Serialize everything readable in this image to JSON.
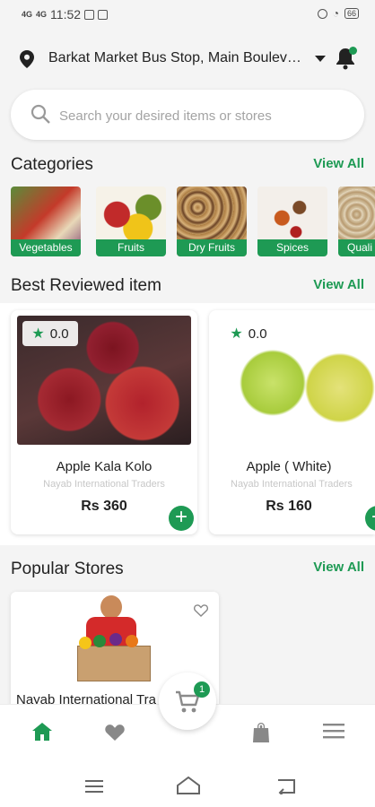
{
  "status_bar": {
    "time": "11:52",
    "left_signal_1": "4G",
    "left_signal_2": "4G",
    "battery": "66"
  },
  "header": {
    "location": "Barkat Market Bus Stop, Main Boulevard...",
    "location_icon": "map-pin-icon",
    "notification_icon": "bell-icon",
    "notification_dot": true
  },
  "search": {
    "placeholder": "Search your desired items or stores",
    "value": ""
  },
  "categories": {
    "title": "Categories",
    "view_all": "View All",
    "items": [
      {
        "label": "Vegetables"
      },
      {
        "label": "Fruits"
      },
      {
        "label": "Dry Fruits"
      },
      {
        "label": "Spices"
      },
      {
        "label": "Quali"
      }
    ]
  },
  "best_reviewed": {
    "title": "Best Reviewed item",
    "view_all": "View All",
    "items": [
      {
        "name": "Apple Kala Kolo",
        "store": "Nayab International Traders",
        "price": "Rs 360",
        "rating": "0.0"
      },
      {
        "name": "Apple ( White)",
        "store": "Nayab International Traders",
        "price": "Rs 160",
        "rating": "0.0"
      }
    ]
  },
  "popular_stores": {
    "title": "Popular Stores",
    "view_all": "View All",
    "stores": [
      {
        "name": "Nayab International Tra"
      }
    ]
  },
  "cart": {
    "count": "1"
  },
  "bottom_nav": [
    "home-icon",
    "heart-icon",
    "cart-icon",
    "bag-icon",
    "menu-icon"
  ],
  "colors": {
    "accent": "#1e9a54",
    "background": "#f4f4f4"
  }
}
